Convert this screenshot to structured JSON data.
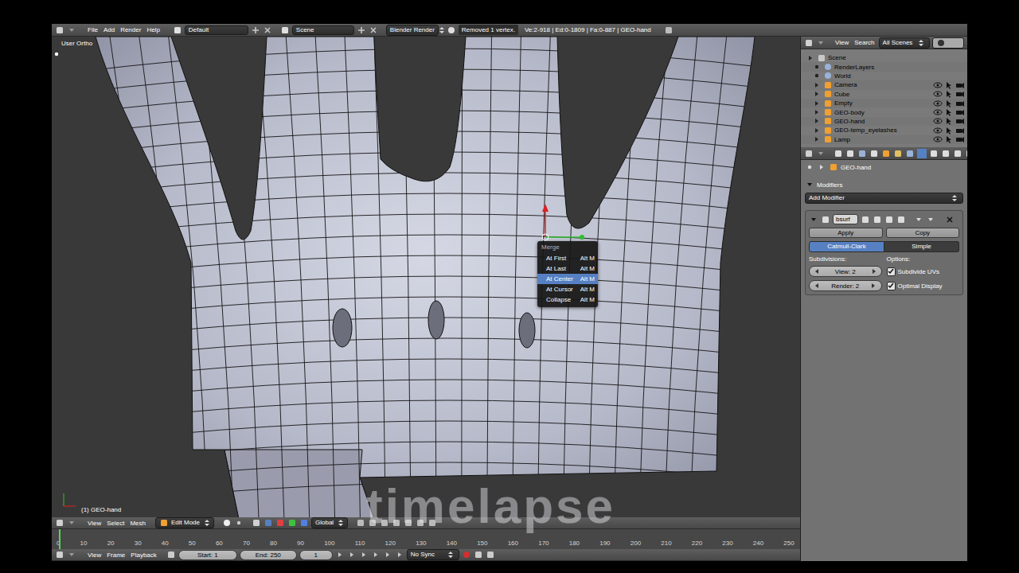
{
  "info_header": {
    "menus": [
      "File",
      "Add",
      "Render",
      "Help"
    ],
    "layout": "Default",
    "scene": "Scene",
    "engine": "Blender Render",
    "report": "Removed 1 vertex.",
    "stats": "Ve:2-918 | Ed:0-1809 | Fa:0-887 | GEO-hand"
  },
  "viewport": {
    "view_label": "User Ortho",
    "object_label": "(1) GEO-hand",
    "watermark": "timelapse"
  },
  "merge_menu": {
    "title": "Merge",
    "items": [
      {
        "label": "At First",
        "shortcut": "Alt M",
        "selected": false
      },
      {
        "label": "At Last",
        "shortcut": "Alt M",
        "selected": false
      },
      {
        "label": "At Center",
        "shortcut": "Alt M",
        "selected": true
      },
      {
        "label": "At Cursor",
        "shortcut": "Alt M",
        "selected": false
      },
      {
        "label": "Collapse",
        "shortcut": "Alt M",
        "selected": false
      }
    ]
  },
  "viewport_header": {
    "menus": [
      "View",
      "Select",
      "Mesh"
    ],
    "mode": "Edit Mode",
    "orientation": "Global"
  },
  "timeline": {
    "ticks": [
      "0",
      "10",
      "20",
      "30",
      "40",
      "50",
      "60",
      "70",
      "80",
      "90",
      "100",
      "110",
      "120",
      "130",
      "140",
      "150",
      "160",
      "170",
      "180",
      "190",
      "200",
      "210",
      "220",
      "230",
      "240",
      "250"
    ],
    "menus": [
      "View",
      "Frame",
      "Playback"
    ],
    "start": "Start: 1",
    "end": "End: 250",
    "frame": "1",
    "sync": "No Sync"
  },
  "outliner": {
    "menus": [
      "View",
      "Search"
    ],
    "filter": "All Scenes",
    "items": [
      {
        "label": "Scene",
        "kind": "scene"
      },
      {
        "label": "RenderLayers",
        "kind": "setting"
      },
      {
        "label": "World",
        "kind": "setting"
      },
      {
        "label": "Camera",
        "kind": "object"
      },
      {
        "label": "Cube",
        "kind": "object"
      },
      {
        "label": "Empty",
        "kind": "object"
      },
      {
        "label": "GEO-body",
        "kind": "object"
      },
      {
        "label": "GEO-hand",
        "kind": "object"
      },
      {
        "label": "GEO-temp_eyelashes",
        "kind": "object"
      },
      {
        "label": "Lamp",
        "kind": "object"
      }
    ]
  },
  "properties": {
    "object": "GEO-hand",
    "section": "Modifiers",
    "expanded": true,
    "add_modifier": "Add Modifier",
    "modifier": {
      "name": "bsurf",
      "apply": "Apply",
      "copy": "Copy",
      "types": [
        {
          "label": "Catmull-Clark",
          "selected": true
        },
        {
          "label": "Simple",
          "selected": false
        }
      ],
      "subdivisions_label": "Subdivisions:",
      "options_label": "Options:",
      "view": "View: 2",
      "render": "Render: 2",
      "options": [
        {
          "label": "Subdivide UVs",
          "checked": true
        },
        {
          "label": "Optimal Display",
          "checked": true
        }
      ]
    }
  }
}
